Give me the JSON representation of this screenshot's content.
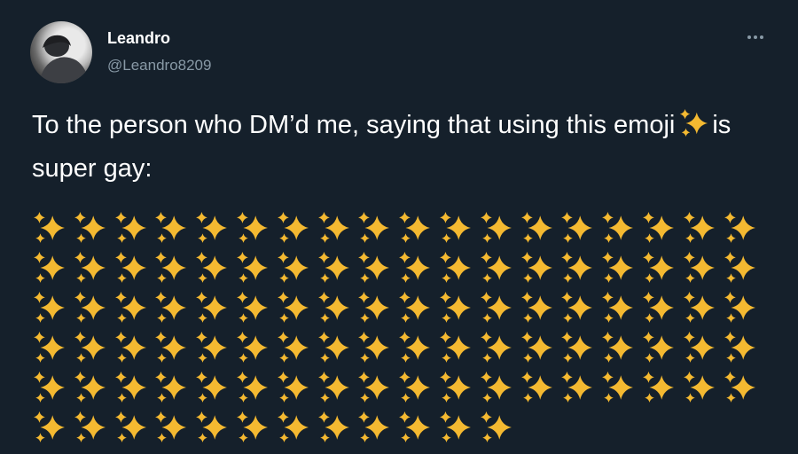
{
  "tweet": {
    "display_name": "Leandro",
    "handle": "@Leandro8209",
    "more_icon": "more-horizontal-icon",
    "text_before": "To the person who DM’d me, saying that using this emoji",
    "text_after": "is super gay:",
    "inline_emoji": "sparkles-emoji"
  },
  "sparkle_grid": {
    "emoji": "sparkles-emoji",
    "rows": [
      18,
      18,
      18,
      18,
      18,
      12
    ]
  },
  "colors": {
    "background": "#15202b",
    "text": "#ffffff",
    "secondary_text": "#8899a6",
    "sparkle": "#f4b931"
  }
}
